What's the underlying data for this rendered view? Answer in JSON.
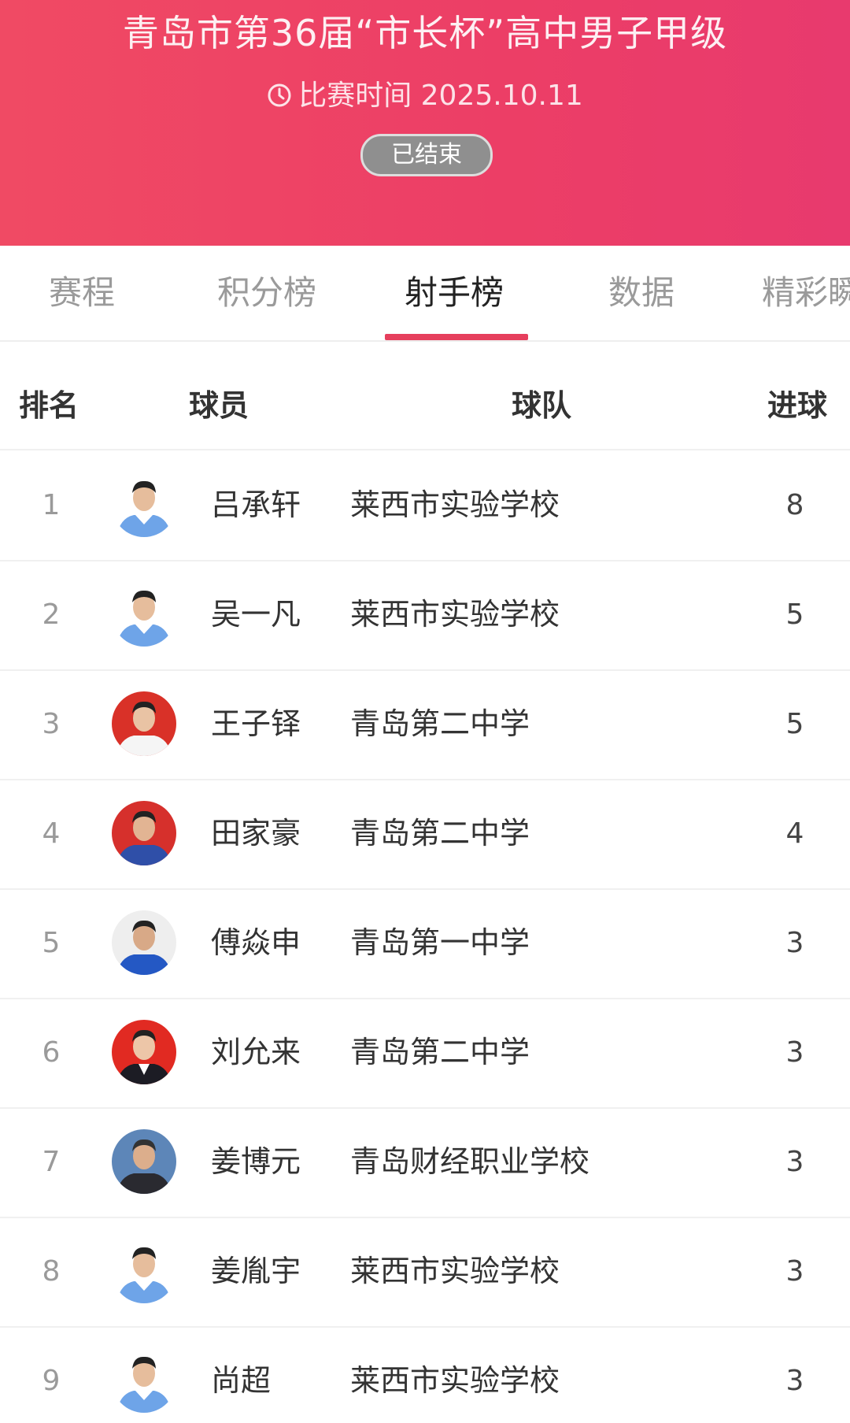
{
  "header": {
    "title": "青岛市第36届“市长杯”高中男子甲级",
    "time_label": "比赛时间 2025.10.11",
    "status": "已结束",
    "icon": "clock-icon",
    "brand_color": "#ec3e66"
  },
  "tabs": [
    {
      "label": "赛程",
      "active": false
    },
    {
      "label": "积分榜",
      "active": false
    },
    {
      "label": "射手榜",
      "active": true
    },
    {
      "label": "数据",
      "active": false
    },
    {
      "label": "精彩瞬",
      "active": false
    }
  ],
  "table": {
    "columns": {
      "rank": "排名",
      "player": "球员",
      "team": "球队",
      "goals": "进球"
    },
    "rows": [
      {
        "rank": "1",
        "player": "吕承轩",
        "team": "莱西市实验学校",
        "goals": "8",
        "avatar_style": "blue-kit"
      },
      {
        "rank": "2",
        "player": "吴一凡",
        "team": "莱西市实验学校",
        "goals": "5",
        "avatar_style": "blue-kit"
      },
      {
        "rank": "3",
        "player": "王子铎",
        "team": "青岛第二中学",
        "goals": "5",
        "avatar_style": "red-bg-white-shirt"
      },
      {
        "rank": "4",
        "player": "田家豪",
        "team": "青岛第二中学",
        "goals": "4",
        "avatar_style": "red-bg-blue-shirt"
      },
      {
        "rank": "5",
        "player": "傅焱申",
        "team": "青岛第一中学",
        "goals": "3",
        "avatar_style": "white-bg-blue-kit"
      },
      {
        "rank": "6",
        "player": "刘允来",
        "team": "青岛第二中学",
        "goals": "3",
        "avatar_style": "red-bg-dark-jacket"
      },
      {
        "rank": "7",
        "player": "姜博元",
        "team": "青岛财经职业学校",
        "goals": "3",
        "avatar_style": "blue-bg-dark-shirt"
      },
      {
        "rank": "8",
        "player": "姜胤宇",
        "team": "莱西市实验学校",
        "goals": "3",
        "avatar_style": "blue-kit"
      },
      {
        "rank": "9",
        "player": "尚超",
        "team": "莱西市实验学校",
        "goals": "3",
        "avatar_style": "blue-kit"
      }
    ]
  }
}
